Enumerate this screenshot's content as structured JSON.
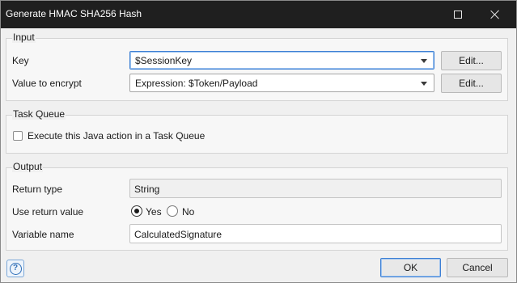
{
  "window": {
    "title": "Generate HMAC SHA256 Hash"
  },
  "input_group": {
    "title": "Input",
    "key_label": "Key",
    "key_value": "$SessionKey",
    "value_label": "Value to encrypt",
    "value_value": "Expression: $Token/Payload",
    "edit_label": "Edit..."
  },
  "task_queue_group": {
    "title": "Task Queue",
    "checkbox_label": "Execute this Java action in a Task Queue",
    "checked": false
  },
  "output_group": {
    "title": "Output",
    "return_type_label": "Return type",
    "return_type_value": "String",
    "use_return_label": "Use return value",
    "yes_label": "Yes",
    "no_label": "No",
    "selected": "Yes",
    "variable_name_label": "Variable name",
    "variable_name_value": "CalculatedSignature"
  },
  "footer": {
    "help_icon": "?",
    "ok_label": "OK",
    "cancel_label": "Cancel"
  },
  "colors": {
    "titlebar": "#1f1f1f",
    "focus_accent": "#3c7fd4"
  }
}
